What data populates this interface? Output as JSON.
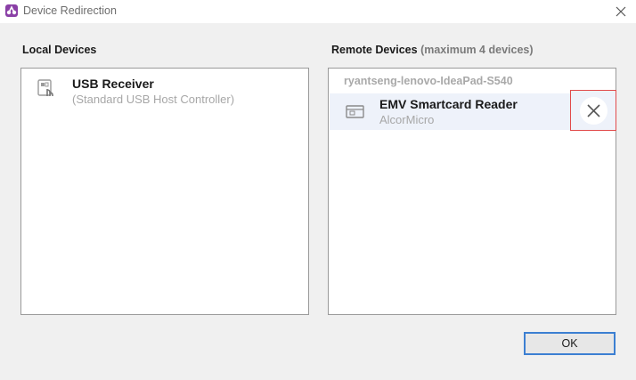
{
  "window": {
    "title": "Device Redirection"
  },
  "local": {
    "label": "Local Devices",
    "devices": [
      {
        "name": "USB Receiver",
        "subtitle": "(Standard USB Host Controller)",
        "icon": "usb-device-icon"
      }
    ]
  },
  "remote": {
    "label": "Remote Devices",
    "label_suffix": "(maximum 4 devices)",
    "host": "ryantseng-lenovo-IdeaPad-S540",
    "devices": [
      {
        "name": "EMV Smartcard Reader",
        "subtitle": "AlcorMicro",
        "icon": "smartcard-reader-icon",
        "selected": true
      }
    ]
  },
  "buttons": {
    "ok": "OK"
  },
  "colors": {
    "accent": "#3c7fd2",
    "remove_highlight": "#e14b4b",
    "selected_row": "#eef2fa",
    "app_icon": "#8a3fa6"
  }
}
